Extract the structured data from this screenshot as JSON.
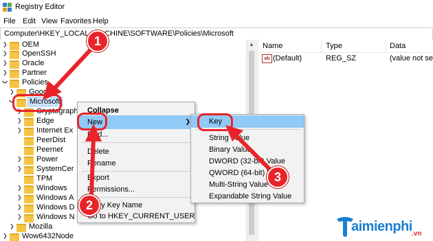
{
  "window": {
    "title": "Registry Editor"
  },
  "menu": [
    "File",
    "Edit",
    "View",
    "Favorites",
    "Help"
  ],
  "address": "Computer\\HKEY_LOCAL_MACHINE\\SOFTWARE\\Policies\\Microsoft",
  "tree": [
    {
      "label": "OEM"
    },
    {
      "label": "OpenSSH"
    },
    {
      "label": "Oracle"
    },
    {
      "label": "Partner"
    },
    {
      "label": "Policies",
      "expanded": true
    },
    {
      "label": "Google"
    },
    {
      "label": "Microsoft",
      "selected": true,
      "expanded": true
    },
    {
      "label": "Cryptography"
    },
    {
      "label": "Edge"
    },
    {
      "label": "Internet Ex"
    },
    {
      "label": "PeerDist"
    },
    {
      "label": "Peernet"
    },
    {
      "label": "Power"
    },
    {
      "label": "SystemCer"
    },
    {
      "label": "TPM"
    },
    {
      "label": "Windows"
    },
    {
      "label": "Windows A"
    },
    {
      "label": "Windows D"
    },
    {
      "label": "Windows N"
    },
    {
      "label": "Mozilla"
    },
    {
      "label": "Wow6432Node"
    }
  ],
  "list": {
    "headers": [
      "Name",
      "Type",
      "Data"
    ],
    "rows": [
      {
        "icon": "ab",
        "name": "(Default)",
        "type": "REG_SZ",
        "data": "(value not set)"
      }
    ]
  },
  "context_menu": [
    {
      "label": "Collapse",
      "bold": true
    },
    {
      "label": "New",
      "submenu": true,
      "highlighted": true
    },
    {
      "label": "Find..."
    },
    {
      "label": "Delete"
    },
    {
      "label": "Rename"
    },
    {
      "label": "Export"
    },
    {
      "label": "Permissions..."
    },
    {
      "label": "Copy Key Name"
    },
    {
      "label": "Go to HKEY_CURRENT_USER"
    }
  ],
  "submenu": [
    {
      "label": "Key",
      "highlighted": true
    },
    {
      "label": "String Value"
    },
    {
      "label": "Binary Value"
    },
    {
      "label": "DWORD (32-bit) Value"
    },
    {
      "label": "QWORD (64-bit) Value"
    },
    {
      "label": "Multi-String Value"
    },
    {
      "label": "Expandable String Value"
    }
  ],
  "annotations": {
    "badge1": "1",
    "badge2": "2",
    "badge3": "3",
    "color": "#e8242a"
  },
  "watermark": {
    "brand": "aimienphi",
    "tld": ".vn"
  }
}
